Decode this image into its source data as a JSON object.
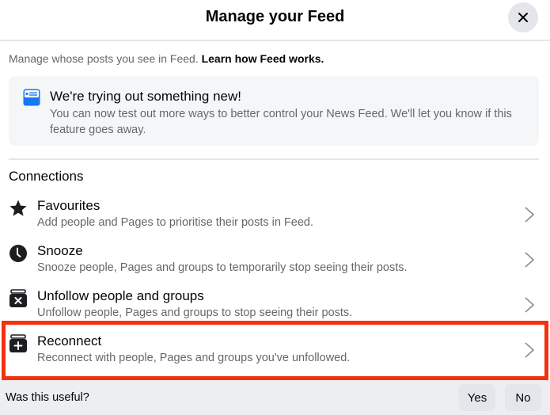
{
  "dialog": {
    "title": "Manage your Feed",
    "close_icon": "close-icon"
  },
  "intro": {
    "text": "Manage whose posts you see in Feed. ",
    "link": "Learn how Feed works."
  },
  "notice": {
    "icon": "feed-card-icon",
    "title": "We're trying out something new!",
    "text": "You can now test out more ways to better control your News Feed. We'll let you know if this feature goes away."
  },
  "connections": {
    "heading": "Connections",
    "items": [
      {
        "icon": "star-icon",
        "title": "Favourites",
        "description": "Add people and Pages to prioritise their posts in Feed."
      },
      {
        "icon": "clock-icon",
        "title": "Snooze",
        "description": "Snooze people, Pages and groups to temporarily stop seeing their posts."
      },
      {
        "icon": "unfollow-icon",
        "title": "Unfollow people and groups",
        "description": "Unfollow people, Pages and groups to stop seeing their posts."
      },
      {
        "icon": "reconnect-icon",
        "title": "Reconnect",
        "description": "Reconnect with people, Pages and groups you've unfollowed."
      }
    ]
  },
  "highlight": {
    "target": "Reconnect",
    "color": "#f5300f"
  },
  "footer": {
    "question": "Was this useful?",
    "yes_label": "Yes",
    "no_label": "No"
  },
  "colors": {
    "accent_blue": "#1877f2",
    "secondary_text": "#65676b",
    "primary_text": "#050505"
  }
}
